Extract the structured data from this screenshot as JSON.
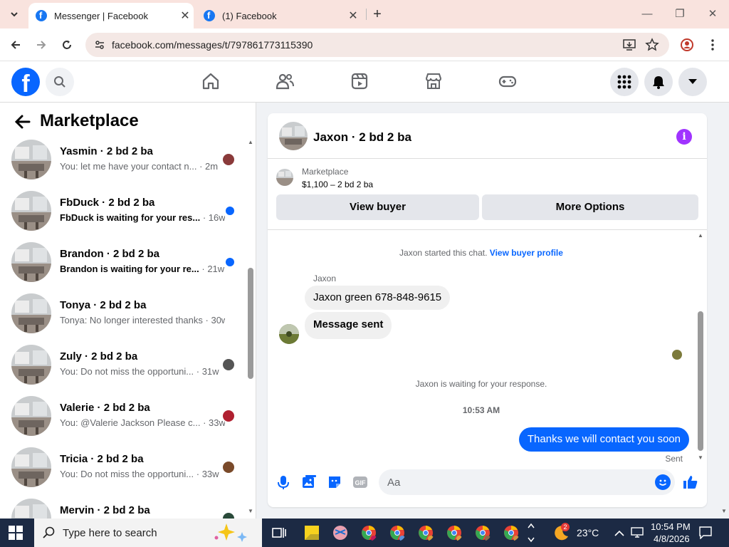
{
  "browser": {
    "tabs": [
      {
        "title": "Messenger | Facebook",
        "active": true
      },
      {
        "title": "(1) Facebook",
        "active": false
      }
    ],
    "url": "facebook.com/messages/t/797861773115390"
  },
  "colors": {
    "fb_blue": "#0866ff",
    "unread_dot": "#0866ff",
    "info_purple": "#a033ff",
    "tab_strip": "#f9e3de"
  },
  "marketplace": {
    "title": "Marketplace",
    "conversations": [
      {
        "name": "Yasmin · 2 bd 2 ba",
        "preview": "You: let me have your contact n...",
        "time": "· 2m",
        "unread": false,
        "avatar_color": "#8a3a3a"
      },
      {
        "name": "FbDuck · 2 bd 2 ba",
        "preview": "FbDuck is waiting for your res...",
        "time": "· 16w",
        "unread": true
      },
      {
        "name": "Brandon · 2 bd 2 ba",
        "preview": "Brandon is waiting for your re...",
        "time": "· 21w",
        "unread": true
      },
      {
        "name": "Tonya · 2 bd 2 ba",
        "preview": "Tonya: No longer interested thanks",
        "time": "· 30w",
        "unread": false
      },
      {
        "name": "Zuly · 2 bd 2 ba",
        "preview": "You: Do not miss the opportuni...",
        "time": "· 31w",
        "unread": false,
        "avatar_color": "#555555"
      },
      {
        "name": "Valerie · 2 bd 2 ba",
        "preview": "You: @Valerie Jackson Please c...",
        "time": "· 33w",
        "unread": false,
        "avatar_color": "#b02030"
      },
      {
        "name": "Tricia · 2 bd 2 ba",
        "preview": "You: Do not miss the opportuni...",
        "time": "· 33w",
        "unread": false,
        "avatar_color": "#7a4a2a"
      },
      {
        "name": "Mervin · 2 bd 2 ba",
        "preview": "",
        "time": "",
        "unread": false,
        "avatar_color": "#2a4a3a"
      }
    ]
  },
  "chat": {
    "title": "Jaxon · 2 bd 2 ba",
    "listing_source": "Marketplace",
    "listing_price": "$1,100 – 2 bd 2 ba",
    "view_buyer": "View buyer",
    "more_options": "More Options",
    "started_text": "Jaxon started this chat.",
    "buyer_profile_link": "View buyer profile",
    "sender_name": "Jaxon",
    "messages_in": [
      "Jaxon green 678-848-9615",
      "Message sent"
    ],
    "waiting_text": "Jaxon is waiting for your response.",
    "timestamp": "10:53 AM",
    "message_out": "Thanks we will contact you soon",
    "sent_status": "Sent",
    "composer_placeholder": "Aa"
  },
  "taskbar": {
    "search_placeholder": "Type here to search",
    "weather": "23°C",
    "weather_badge": "2",
    "time": "10:54 PM",
    "date": "4/8/2026"
  }
}
